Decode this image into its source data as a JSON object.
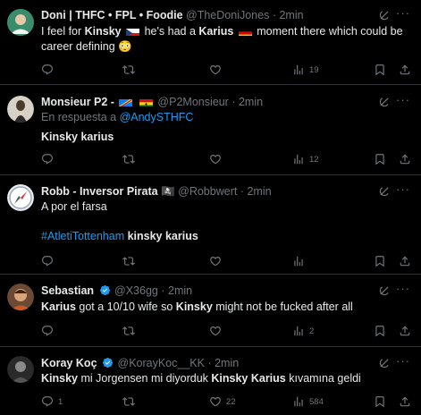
{
  "tweets": [
    {
      "name": "Doni | THFC • FPL • Foodie",
      "handle": "@TheDoniJones",
      "sep": "·",
      "time": "2min",
      "text_1": "I feel for ",
      "bold_1": "Kinsky",
      "text_2": " he's had a ",
      "bold_2": "Karius",
      "text_3": " moment there which could be",
      "line_2": "career defining ",
      "emoji": "😳",
      "views": "19"
    },
    {
      "name": "Monsieur P2 -",
      "handle": "@P2Monsieur",
      "sep": "·",
      "time": "2min",
      "reply_prefix": "En respuesta a ",
      "reply_to": "@AndySTHFC",
      "text_bold": "Kinsky karius",
      "views": "12"
    },
    {
      "name": "Robb - Inversor Pirata",
      "pirate_emoji": "🏴‍☠️",
      "handle": "@Robbwert",
      "sep": "·",
      "time": "2min",
      "text_1": "A por el farsa",
      "hashtag": "#AtletiTottenham",
      "text_bold": " kinsky karius"
    },
    {
      "name": "Sebastian",
      "handle": "@X36gg",
      "sep": "·",
      "time": "2min",
      "bold_1": "Karius",
      "text_1": " got a 10/10 wife so ",
      "bold_2": "Kinsky",
      "text_2": " might not be fucked after all",
      "views": "2"
    },
    {
      "name": "Koray Koç",
      "handle": "@KorayKoc__KK",
      "sep": "·",
      "time": "2min",
      "bold_1": "Kinsky",
      "text_1": " mi Jorgensen mi diyorduk ",
      "bold_2": "Kinsky Karius",
      "text_2": " kıvamına geldi",
      "replies": "1",
      "likes": "22",
      "views": "584"
    }
  ],
  "icons": {
    "more": "more-icon",
    "grok": "grok-icon",
    "reply": "reply-icon",
    "retweet": "retweet-icon",
    "like": "like-icon",
    "views": "views-icon",
    "bookmark": "bookmark-icon",
    "share": "share-icon"
  },
  "colors": {
    "background": "#000000",
    "text": "#e7e9ea",
    "secondary": "#71767b",
    "link": "#1d9bf0",
    "divider": "#2f3336",
    "verified": "#1d9bf0"
  }
}
